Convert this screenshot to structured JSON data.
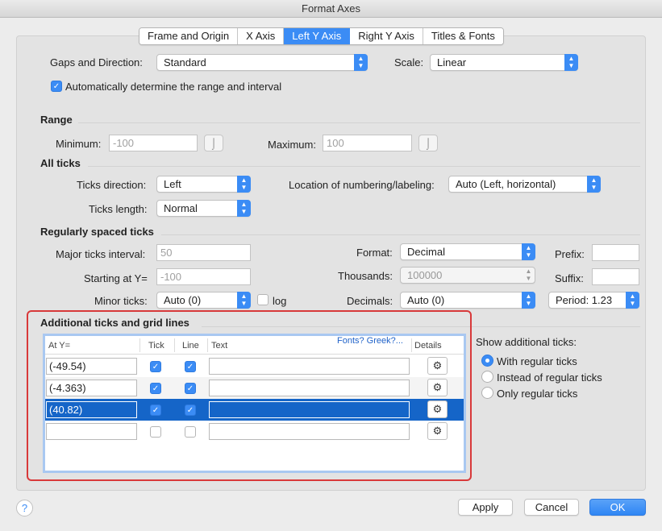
{
  "window": {
    "title": "Format Axes"
  },
  "tabs": [
    "Frame and Origin",
    "X Axis",
    "Left Y Axis",
    "Right Y Axis",
    "Titles & Fonts"
  ],
  "active_tab": "Left Y Axis",
  "top": {
    "gaps_label": "Gaps and Direction:",
    "gaps_value": "Standard",
    "scale_label": "Scale:",
    "scale_value": "Linear",
    "auto_checkbox_label": "Automatically determine the range and interval",
    "auto_checked": true
  },
  "range": {
    "title": "Range",
    "min_label": "Minimum:",
    "min_value": "-100",
    "max_label": "Maximum:",
    "max_value": "100"
  },
  "all_ticks": {
    "title": "All ticks",
    "direction_label": "Ticks direction:",
    "direction_value": "Left",
    "location_label": "Location of numbering/labeling:",
    "location_value": "Auto (Left, horizontal)",
    "length_label": "Ticks length:",
    "length_value": "Normal"
  },
  "regular": {
    "title": "Regularly spaced ticks",
    "major_label": "Major ticks interval:",
    "major_value": "50",
    "start_label": "Starting at Y=",
    "start_value": "-100",
    "minor_label": "Minor ticks:",
    "minor_value": "Auto (0)",
    "log_label": "log",
    "format_label": "Format:",
    "format_value": "Decimal",
    "thousands_label": "Thousands:",
    "thousands_value": "100000",
    "decimals_label": "Decimals:",
    "decimals_value": "Auto (0)",
    "prefix_label": "Prefix:",
    "suffix_label": "Suffix:",
    "period_value": "Period: 1.23"
  },
  "additional": {
    "title": "Additional ticks and grid lines",
    "columns": {
      "at": "At Y=",
      "tick": "Tick",
      "line": "Line",
      "text": "Text",
      "details": "Details"
    },
    "fonts_link": "Fonts? Greek?...",
    "rows": [
      {
        "at": "(-49.54)",
        "tick": true,
        "line": true,
        "text": ""
      },
      {
        "at": "(-4.363)",
        "tick": true,
        "line": true,
        "text": ""
      },
      {
        "at": "(40.82)",
        "tick": true,
        "line": true,
        "text": ""
      },
      {
        "at": "",
        "tick": false,
        "line": false,
        "text": ""
      }
    ],
    "selected_row": 2,
    "show_label": "Show additional ticks:",
    "options": [
      "With regular ticks",
      "Instead of regular ticks",
      "Only regular ticks"
    ],
    "selected_option": 0
  },
  "footer": {
    "help": "?",
    "apply": "Apply",
    "cancel": "Cancel",
    "ok": "OK"
  },
  "colors": {
    "accent": "#3b8cf5",
    "highlight": "#d8393a",
    "selection": "#1565c8"
  },
  "icons": {
    "gear": "gear-icon",
    "hook": "hook-icon",
    "check": "checkmark-icon"
  }
}
